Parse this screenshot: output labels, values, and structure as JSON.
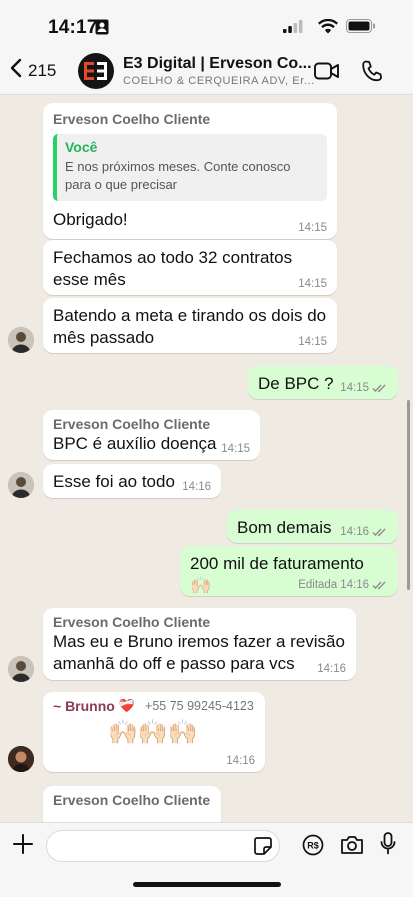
{
  "status_bar": {
    "time": "14:17"
  },
  "header": {
    "back_count": "215",
    "title": "E3 Digital | Erveson Co...",
    "subtitle": "COELHO & CERQUEIRA ADV, Er..."
  },
  "messages": [
    {
      "sender": "Erveson Coelho Cliente",
      "quote_author": "Você",
      "quote_text": "E nos próximos meses. Conte conosco para o que precisar",
      "text": "Obrigado!",
      "time": "14:15"
    },
    {
      "text": "Fechamos ao todo 32 contratos esse mês",
      "time": "14:15"
    },
    {
      "text": "Batendo a meta e tirando os dois do mês passado",
      "time": "14:15"
    },
    {
      "text": "De BPC ?",
      "time": "14:15"
    },
    {
      "sender": "Erveson Coelho Cliente",
      "text": "BPC é auxílio doença",
      "time": "14:15"
    },
    {
      "text": "Esse foi ao todo",
      "time": "14:16"
    },
    {
      "text": "Bom demais",
      "time": "14:16"
    },
    {
      "text": "200 mil de faturamento 🙌🏻",
      "edited": "Editada",
      "time": "14:16"
    },
    {
      "sender": "Erveson Coelho Cliente",
      "text": "Mas eu e Bruno iremos fazer a revisão amanhã do off e passo para vcs",
      "time": "14:16"
    },
    {
      "sender": "~ Brunno",
      "sender_emoji": "❤️‍🩹",
      "phone": "+55 75 99245-4123",
      "text": "🙌🏻🙌🏻🙌🏻",
      "time": "14:16"
    },
    {
      "sender": "Erveson Coelho Cliente",
      "text": ""
    }
  ],
  "icons": [
    "back-chevron-icon",
    "video-call-icon",
    "phone-icon",
    "plus-icon",
    "sticker-icon",
    "payment-icon",
    "camera-icon",
    "microphone-icon"
  ],
  "colors": {
    "outgoing": "#d9fdd3",
    "incoming": "#ffffff",
    "quote_accent": "#25d366",
    "read_ticks": "#53bdeb"
  }
}
